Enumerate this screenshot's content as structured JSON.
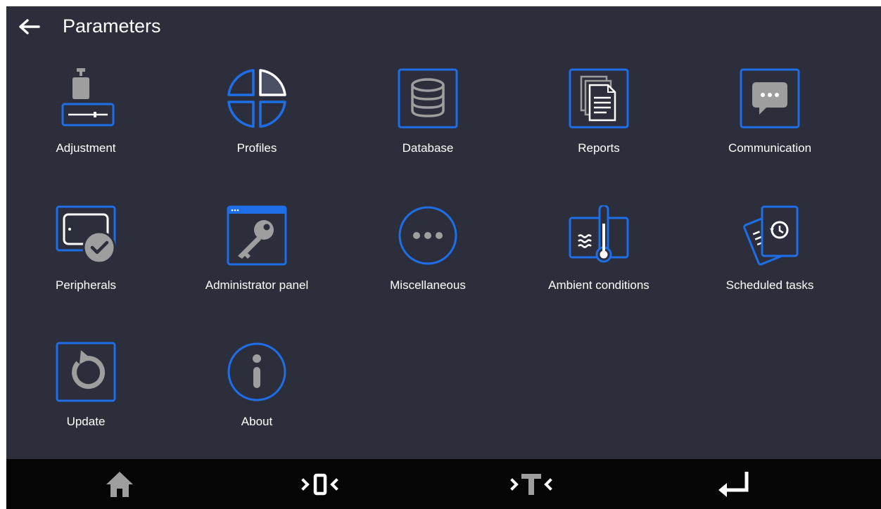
{
  "header": {
    "title": "Parameters",
    "back_icon": "arrow-left-icon"
  },
  "colors": {
    "background": "#2c2f3b",
    "accent_blue": "#1e6ee8",
    "icon_gray": "#9e9e9e",
    "bottom_bar": "#050505",
    "text": "#ffffff"
  },
  "menu": {
    "items": [
      {
        "label": "Adjustment",
        "icon": "weight-adjustment-icon"
      },
      {
        "label": "Profiles",
        "icon": "profiles-pie-icon"
      },
      {
        "label": "Database",
        "icon": "database-icon"
      },
      {
        "label": "Reports",
        "icon": "reports-icon"
      },
      {
        "label": "Communication",
        "icon": "chat-bubble-icon"
      },
      {
        "label": "Peripherals",
        "icon": "peripherals-tablet-check-icon"
      },
      {
        "label": "Administrator panel",
        "icon": "admin-key-icon"
      },
      {
        "label": "Miscellaneous",
        "icon": "ellipsis-circle-icon"
      },
      {
        "label": "Ambient conditions",
        "icon": "thermometer-icon"
      },
      {
        "label": "Scheduled tasks",
        "icon": "scheduled-tasks-icon"
      },
      {
        "label": "Update",
        "icon": "update-icon"
      },
      {
        "label": "About",
        "icon": "info-icon"
      }
    ]
  },
  "bottom_bar": {
    "buttons": [
      {
        "name": "home",
        "icon": "home-icon"
      },
      {
        "name": "zero",
        "icon": "zero-icon"
      },
      {
        "name": "tare",
        "icon": "tare-icon"
      },
      {
        "name": "enter",
        "icon": "enter-icon"
      }
    ]
  }
}
